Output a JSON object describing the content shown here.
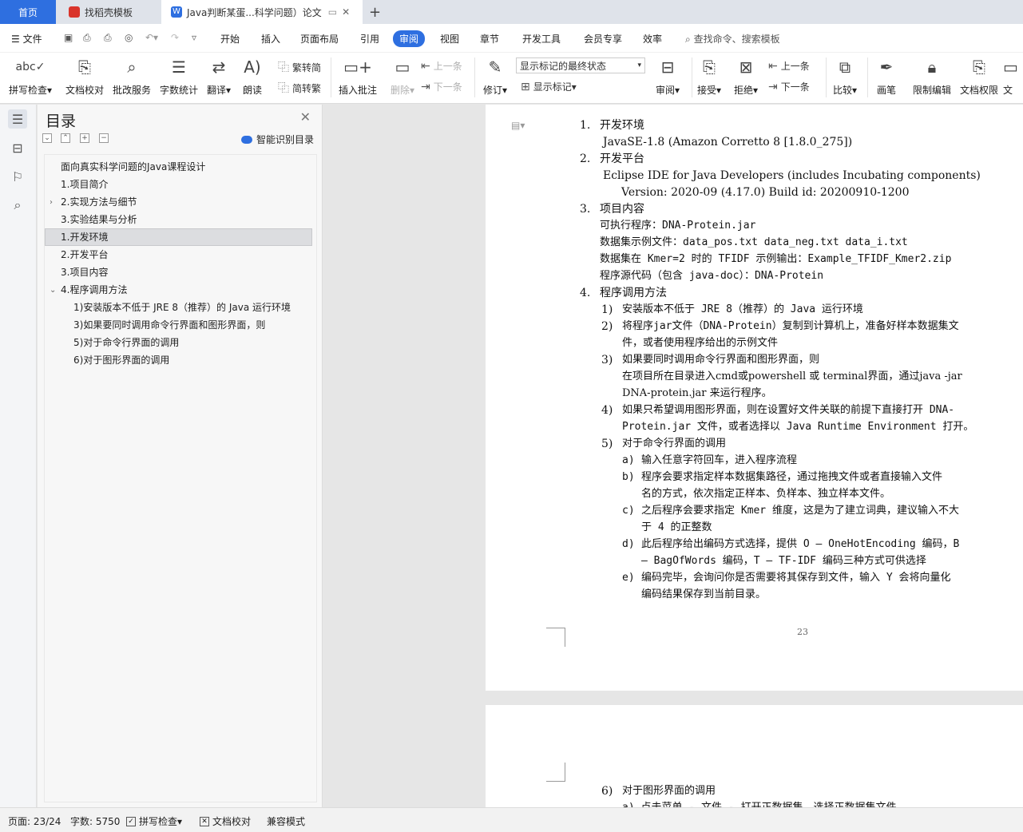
{
  "tabs": {
    "home": "首页",
    "templates": "找稻壳模板",
    "document": "Java判断某蛋...科学问题）论文"
  },
  "menu": {
    "file": "文件",
    "items": [
      "开始",
      "插入",
      "页面布局",
      "引用",
      "审阅",
      "视图",
      "章节",
      "开发工具",
      "会员专享",
      "效率"
    ],
    "search": "查找命令、搜索模板"
  },
  "ribbon": {
    "spell": "拼写检查",
    "proof": "文档校对",
    "correct_service": "批改服务",
    "word_count": "字数统计",
    "translate": "翻译",
    "read_aloud": "朗读",
    "trad_to_simp": "繁转简",
    "simp_to_trad": "简转繁",
    "insert_comment": "插入批注",
    "delete": "删除",
    "prev_comment": "上一条",
    "next_comment": "下一条",
    "track": "修订",
    "markup_select": "显示标记的最终状态",
    "show_markup": "显示标记",
    "review": "审阅",
    "accept": "接受",
    "reject": "拒绝",
    "prev": "上一条",
    "next": "下一条",
    "compare": "比较",
    "pen": "画笔",
    "restrict": "限制编辑",
    "doc_perm": "文档权限",
    "doc_more": "文"
  },
  "nav": {
    "title": "目录",
    "smart_toc": "智能识别目录",
    "items": [
      "面向真实科学问题的Java课程设计",
      "1.项目简介",
      "2.实现方法与细节",
      "3.实验结果与分析",
      "1.开发环境",
      "2.开发平台",
      "3.项目内容",
      "4.程序调用方法",
      "1)安装版本不低于 JRE 8（推荐）的 Java 运行环境",
      "3)如果要同时调用命令行界面和图形界面，则",
      "5)对于命令行界面的调用",
      "6)对于图形界面的调用"
    ]
  },
  "doc": {
    "l1": "1.",
    "l1t": "开发环境",
    "l2": "JavaSE-1.8 (Amazon Corretto 8 [1.8.0_275])",
    "l3": "2.",
    "l3t": "开发平台",
    "l4": "Eclipse IDE for Java Developers (includes Incubating components)",
    "l5": "Version: 2020-09 (4.17.0) Build id: 20200910-1200",
    "l6": "3.",
    "l6t": "项目内容",
    "l7": "可执行程序：DNA-Protein.jar",
    "l8": "数据集示例文件：data_pos.txt data_neg.txt data_i.txt",
    "l9": "数据集在 Kmer=2 时的 TFIDF 示例输出：Example_TFIDF_Kmer2.zip",
    "l10": "程序源代码（包含 java-doc）：DNA-Protein",
    "l11": "4.",
    "l11t": "程序调用方法",
    "s1": "1)",
    "s1t": "安装版本不低于 JRE 8（推荐）的 Java 运行环境",
    "s2": "2)",
    "s2t": "将程序jar文件（DNA-Protein）复制到计算机上，准备好样本数据集文",
    "s2b": "件，或者使用程序给出的示例文件",
    "s3": "3)",
    "s3t": "如果要同时调用命令行界面和图形界面，则",
    "s3b": "在项目所在目录进入cmd或powershell 或 terminal界面，通过java -jar",
    "s3c": "DNA-protein.jar 来运行程序。",
    "s4": "4)",
    "s4t": "如果只希望调用图形界面，则在设置好文件关联的前提下直接打开 DNA-",
    "s4b": "Protein.jar 文件，或者选择以 Java Runtime Environment 打开。",
    "s5": "5)",
    "s5t": "对于命令行界面的调用",
    "a": "a)",
    "at": "输入任意字符回车，进入程序流程",
    "b": "b)",
    "bt": "程序会要求指定样本数据集路径，通过拖拽文件或者直接输入文件",
    "bb": "名的方式，依次指定正样本、负样本、独立样本文件。",
    "c": "c)",
    "ct": "之后程序会要求指定 Kmer 维度，这是为了建立词典，建议输入不大",
    "cb": "于 4 的正整数",
    "d": "d)",
    "dt": "此后程序给出编码方式选择，提供 O – OneHotEncoding 编码，B",
    "db": "– BagOfWords 编码，T – TF-IDF 编码三种方式可供选择",
    "e": "e)",
    "et": "编码完毕，会询问你是否需要将其保存到文件，输入 Y 会将向量化",
    "eb": "编码结果保存到当前目录。",
    "page_num": "23",
    "s6": "6)",
    "s6t": "对于图形界面的调用",
    "s6b": "a) 点击菜单 - 文件 - 打开正数据集，选择正数据集文件"
  },
  "status": {
    "page": "页面: 23/24",
    "words": "字数: 5750",
    "spell": "拼写检查",
    "proof": "文档校对",
    "compat": "兼容模式"
  },
  "colors": {
    "accent": "#2e6fe0"
  }
}
